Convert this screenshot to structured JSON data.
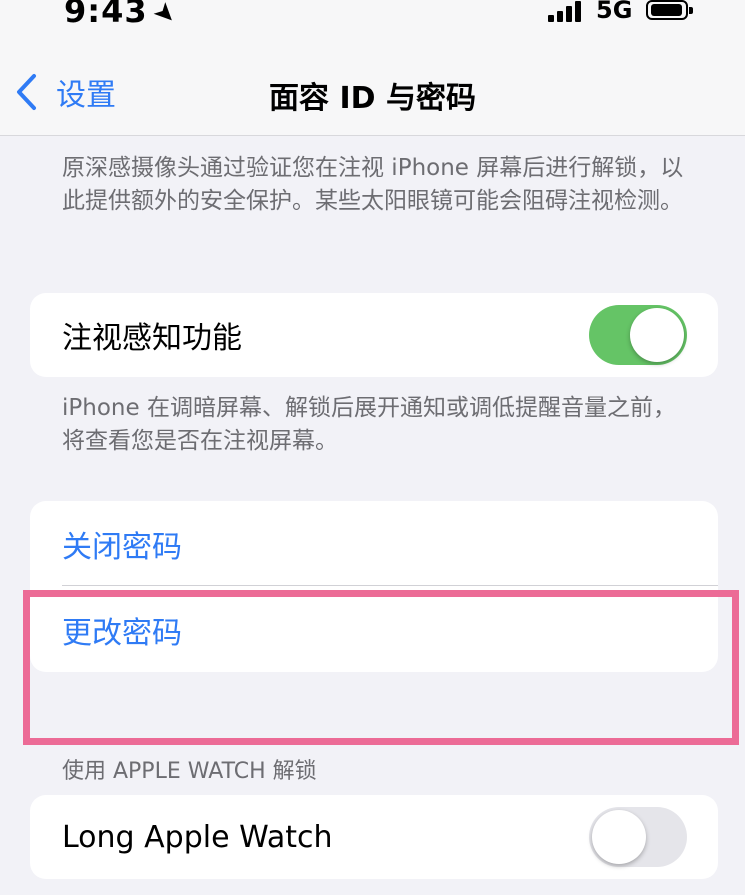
{
  "status": {
    "time": "9:43",
    "network": "5G"
  },
  "nav": {
    "back_label": "设置",
    "title": "面容 ID 与密码"
  },
  "attention_note": "原深感摄像头通过验证您在注视 iPhone 屏幕后进行解锁，以此提供额外的安全保护。某些太阳眼镜可能会阻碍注视检测。",
  "awareness": {
    "label": "注视感知功能",
    "enabled": true
  },
  "awareness_note": "iPhone 在调暗屏幕、解锁后展开通知或调低提醒音量之前，将查看您是否在注视屏幕。",
  "passcode": {
    "turn_off": "关闭密码",
    "change": "更改密码"
  },
  "watch_section": {
    "header": "使用 APPLE WATCH 解锁",
    "label": "Long Apple Watch",
    "enabled": false
  },
  "colors": {
    "accent": "#2f7bf5",
    "toggle_on": "#65c466",
    "highlight": "#ec6b96"
  }
}
